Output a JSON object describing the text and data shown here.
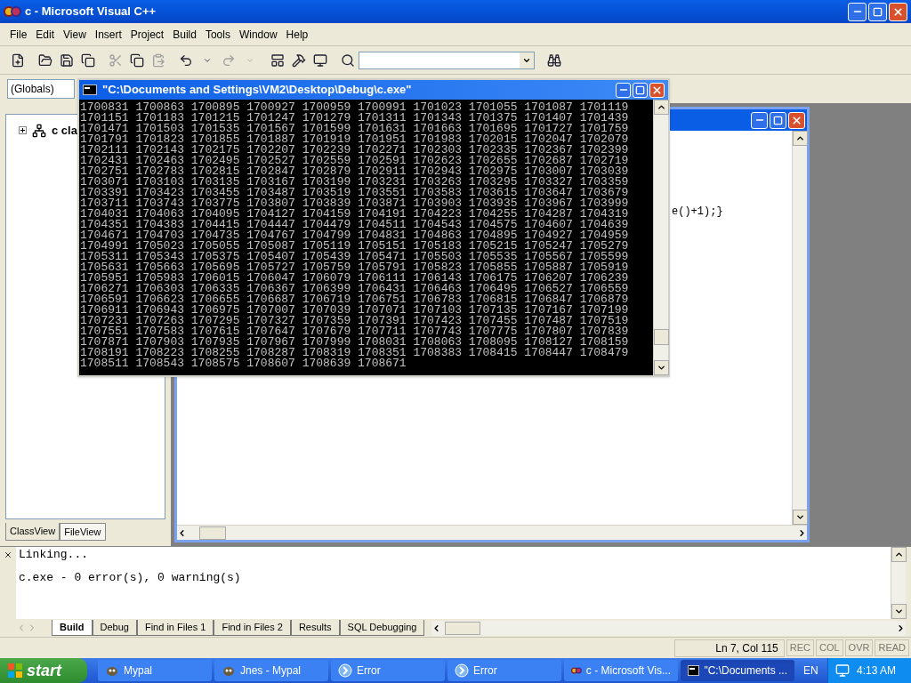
{
  "window": {
    "title": "c - Microsoft Visual C++"
  },
  "menu": [
    "File",
    "Edit",
    "View",
    "Insert",
    "Project",
    "Build",
    "Tools",
    "Window",
    "Help"
  ],
  "wizard_bar": {
    "scope": "(Globals)"
  },
  "workspace": {
    "tree": [
      {
        "label": "c cla",
        "expanded": false
      }
    ],
    "tabs": [
      {
        "label": "ClassView",
        "selected": true
      },
      {
        "label": "FileView",
        "selected": false
      }
    ]
  },
  "editor": {
    "code_lines": [
      "e()+1);}"
    ]
  },
  "console": {
    "title": "\"C:\\Documents and Settings\\VM2\\Desktop\\Debug\\c.exe\"",
    "lines": [
      "1700831 1700863 1700895 1700927 1700959 1700991 1701023 1701055 1701087 1701119",
      "1701151 1701183 1701215 1701247 1701279 1701311 1701343 1701375 1701407 1701439",
      "1701471 1701503 1701535 1701567 1701599 1701631 1701663 1701695 1701727 1701759",
      "1701791 1701823 1701855 1701887 1701919 1701951 1701983 1702015 1702047 1702079",
      "1702111 1702143 1702175 1702207 1702239 1702271 1702303 1702335 1702367 1702399",
      "1702431 1702463 1702495 1702527 1702559 1702591 1702623 1702655 1702687 1702719",
      "1702751 1702783 1702815 1702847 1702879 1702911 1702943 1702975 1703007 1703039",
      "1703071 1703103 1703135 1703167 1703199 1703231 1703263 1703295 1703327 1703359",
      "1703391 1703423 1703455 1703487 1703519 1703551 1703583 1703615 1703647 1703679",
      "1703711 1703743 1703775 1703807 1703839 1703871 1703903 1703935 1703967 1703999",
      "1704031 1704063 1704095 1704127 1704159 1704191 1704223 1704255 1704287 1704319",
      "1704351 1704383 1704415 1704447 1704479 1704511 1704543 1704575 1704607 1704639",
      "1704671 1704703 1704735 1704767 1704799 1704831 1704863 1704895 1704927 1704959",
      "1704991 1705023 1705055 1705087 1705119 1705151 1705183 1705215 1705247 1705279",
      "1705311 1705343 1705375 1705407 1705439 1705471 1705503 1705535 1705567 1705599",
      "1705631 1705663 1705695 1705727 1705759 1705791 1705823 1705855 1705887 1705919",
      "1705951 1705983 1706015 1706047 1706079 1706111 1706143 1706175 1706207 1706239",
      "1706271 1706303 1706335 1706367 1706399 1706431 1706463 1706495 1706527 1706559",
      "1706591 1706623 1706655 1706687 1706719 1706751 1706783 1706815 1706847 1706879",
      "1706911 1706943 1706975 1707007 1707039 1707071 1707103 1707135 1707167 1707199",
      "1707231 1707263 1707295 1707327 1707359 1707391 1707423 1707455 1707487 1707519",
      "1707551 1707583 1707615 1707647 1707679 1707711 1707743 1707775 1707807 1707839",
      "1707871 1707903 1707935 1707967 1707999 1708031 1708063 1708095 1708127 1708159",
      "1708191 1708223 1708255 1708287 1708319 1708351 1708383 1708415 1708447 1708479",
      "1708511 1708543 1708575 1708607 1708639 1708671"
    ]
  },
  "output": {
    "lines": [
      "Linking...",
      "c.exe - 0 error(s), 0 warning(s)"
    ],
    "tabs": [
      {
        "label": "Build",
        "selected": true
      },
      {
        "label": "Debug",
        "selected": false
      },
      {
        "label": "Find in Files 1",
        "selected": false
      },
      {
        "label": "Find in Files 2",
        "selected": false
      },
      {
        "label": "Results",
        "selected": false
      },
      {
        "label": "SQL Debugging",
        "selected": false
      }
    ]
  },
  "status_bar": {
    "position": "Ln 7, Col 115",
    "indicators": [
      {
        "label": "REC",
        "on": false
      },
      {
        "label": "COL",
        "on": false
      },
      {
        "label": "OVR",
        "on": false
      },
      {
        "label": "READ",
        "on": false
      }
    ]
  },
  "taskbar": {
    "start": "start",
    "buttons": [
      {
        "label": "Mypal",
        "kind": "browser",
        "selected": false
      },
      {
        "label": "Jnes - Mypal",
        "kind": "browser",
        "selected": false
      },
      {
        "label": "Error",
        "kind": "error",
        "selected": false
      },
      {
        "label": "Error",
        "kind": "error",
        "selected": false
      },
      {
        "label": "c - Microsoft Vis...",
        "kind": "ide",
        "selected": false
      },
      {
        "label": "\"C:\\Documents ...",
        "kind": "console",
        "selected": true
      }
    ],
    "language": "EN",
    "clock": "4:13 AM"
  }
}
